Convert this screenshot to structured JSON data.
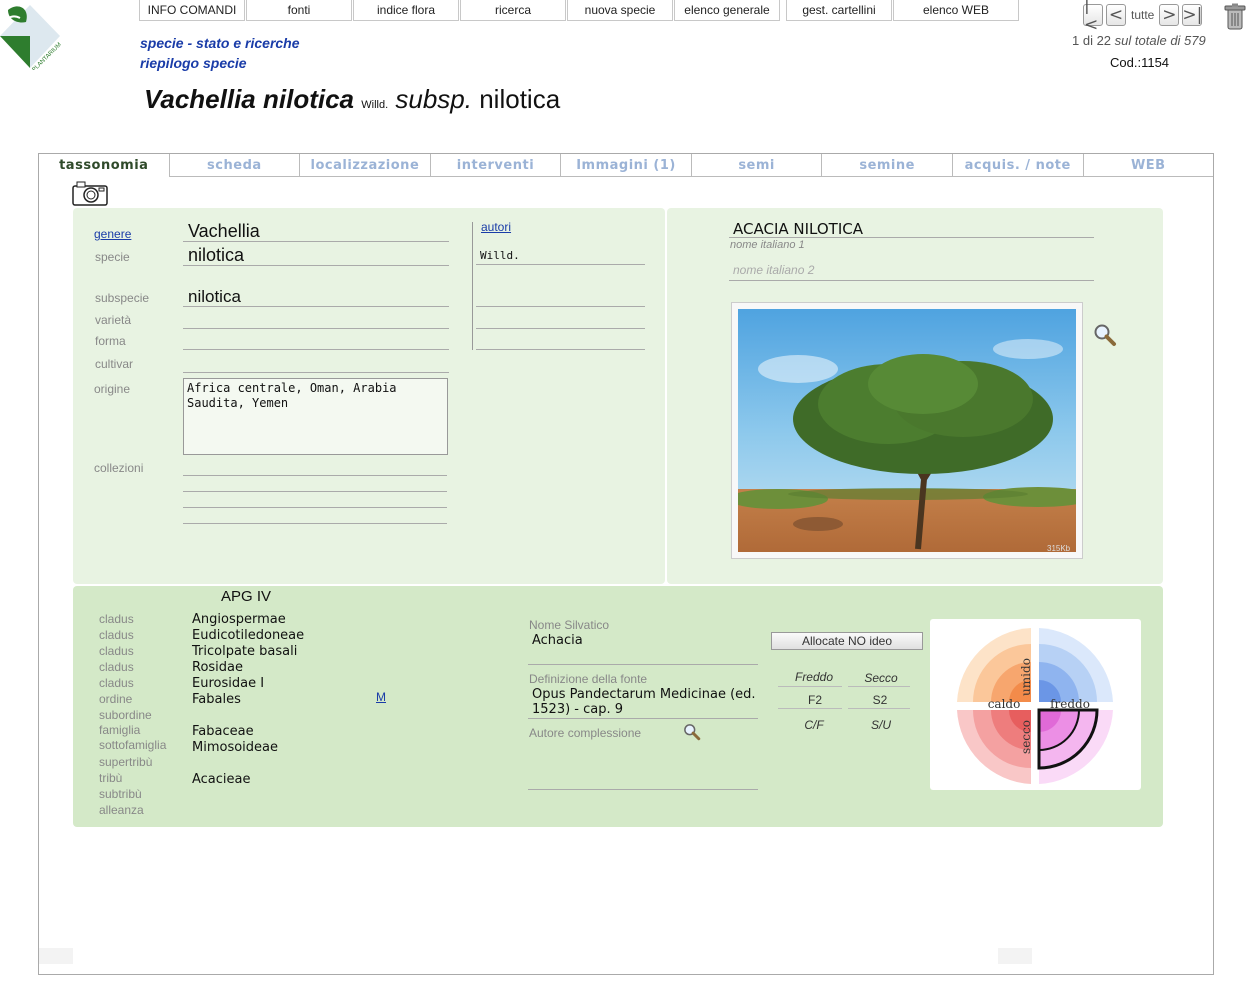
{
  "menu": [
    "INFO COMANDI",
    "fonti",
    "indice flora",
    "ricerca",
    "nuova specie",
    "elenco generale",
    "gest. cartellini",
    "elenco WEB"
  ],
  "breadcrumb": {
    "line1": "specie - stato e ricerche",
    "line2": "riepilogo specie"
  },
  "title": {
    "genus_species": "Vachellia nilotica",
    "author": "Willd.",
    "rank": "subsp.",
    "infra": "nilotica"
  },
  "nav": {
    "first": "|<",
    "prev": "<",
    "all": "tutte",
    "next": ">",
    "last": ">|",
    "position": "1 di 22",
    "total": "sul totale di 579",
    "code": "Cod.:1154"
  },
  "tabs": [
    "tassonomia",
    "scheda",
    "localizzazione",
    "interventi",
    "Immagini (1)",
    "semi",
    "semine",
    "acquis. / note",
    "WEB"
  ],
  "taxonomy": {
    "genere_label": "genere",
    "genere": "Vachellia",
    "specie_label": "specie",
    "specie": "nilotica",
    "subspecie_label": "subspecie",
    "subspecie": "nilotica",
    "varieta_label": "varietà",
    "forma_label": "forma",
    "cultivar_label": "cultivar",
    "origine_label": "origine",
    "origine": "Africa centrale, Oman, Arabia Saudita, Yemen",
    "collezioni_label": "collezioni",
    "autori_label": "autori",
    "autore_specie": "Willd."
  },
  "common_names": {
    "nome1": "ACACIA NILOTICA",
    "nome1_label": "nome italiano 1",
    "nome2_placeholder": "nome italiano 2"
  },
  "image": {
    "size_label": "315Kb"
  },
  "apg": {
    "title": "APG IV",
    "rows": [
      {
        "label": "cladus",
        "value": "Angiospermae"
      },
      {
        "label": "cladus",
        "value": "Eudicotiledoneae"
      },
      {
        "label": "cladus",
        "value": "Tricolpate basali"
      },
      {
        "label": "cladus",
        "value": "Rosidae"
      },
      {
        "label": "cladus",
        "value": "Eurosidae I"
      },
      {
        "label": "ordine",
        "value": "Fabales"
      },
      {
        "label": "subordine",
        "value": ""
      },
      {
        "label": "famiglia",
        "value": "Fabaceae"
      },
      {
        "label": "sottofamiglia",
        "value": "Mimosoideae"
      },
      {
        "label": "supertribù",
        "value": ""
      },
      {
        "label": "tribù",
        "value": "Acacieae"
      },
      {
        "label": "subtribù",
        "value": ""
      },
      {
        "label": "alleanza",
        "value": ""
      }
    ],
    "m_link": "M"
  },
  "silvatico": {
    "nome_label": "Nome Silvatico",
    "nome": "Achacia",
    "def_label": "Definizione della fonte",
    "def": "Opus Pandectarum Medicinae (ed. 1523) - cap. 9",
    "autore_label": "Autore complessione"
  },
  "climate": {
    "button": "Allocate NO ideo",
    "col1_head": "Freddo",
    "col2_head": "Secco",
    "col1_val": "F2",
    "col2_val": "S2",
    "col1_sub": "C/F",
    "col2_sub": "S/U"
  },
  "wheel": {
    "umido": "umido",
    "caldo": "caldo",
    "freddo": "freddo",
    "secco": "secco"
  },
  "colors": {
    "link": "#1a3ca8",
    "panel": "#e8f3e2",
    "panel_dark": "#d4e9c8",
    "tab_inactive": "#9bb3d6",
    "tab_active": "#2f4a2a"
  }
}
